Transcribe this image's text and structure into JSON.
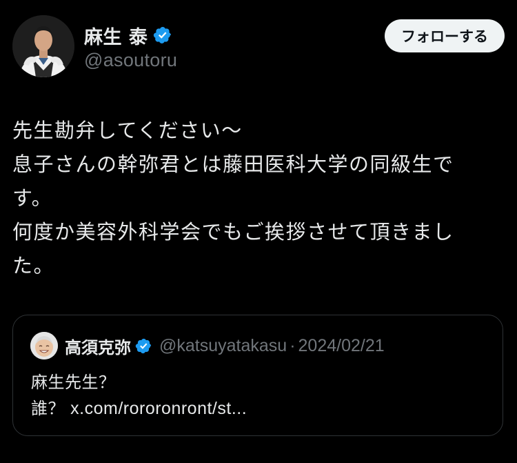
{
  "colors": {
    "background": "#000000",
    "text_primary": "#e7e9ea",
    "text_secondary": "#71767b",
    "verified_blue": "#1d9bf0",
    "follow_bg": "#eff3f4",
    "border": "#2f3336"
  },
  "author": {
    "name": "麻生 泰",
    "handle": "@asoutoru",
    "verified_icon": "verified-badge-icon",
    "avatar": "avatar"
  },
  "follow_button": {
    "label": "フォローする"
  },
  "tweet": {
    "lines": [
      "先生勘弁してください〜",
      "息子さんの幹弥君とは藤田医科大学の同級生で",
      "す。",
      "何度か美容外科学会でもご挨拶させて頂きまし",
      "た。"
    ]
  },
  "quote": {
    "name": "高須克弥",
    "handle": "@katsuyatakasu",
    "separator": "·",
    "date": "2024/02/21",
    "text_line1": "麻生先生？",
    "text_line2_prefix": "誰？ ",
    "text_line2_link": "x.com/rororonront/st..."
  }
}
